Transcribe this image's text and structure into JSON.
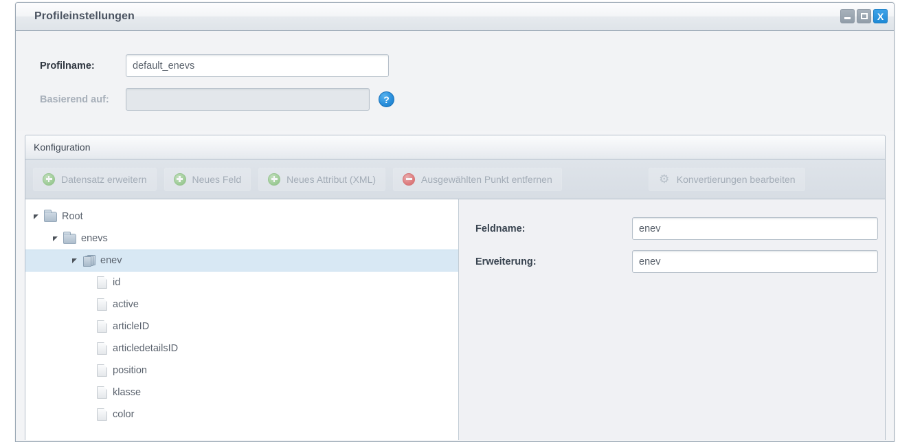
{
  "window": {
    "title": "Profileinstellungen",
    "controls": [
      {
        "name": "minimize",
        "glyph": "minimize-icon"
      },
      {
        "name": "maximize",
        "glyph": "maximize-icon"
      },
      {
        "name": "close",
        "glyph": "close-icon",
        "label": "X",
        "color": "#2a8fdc"
      }
    ]
  },
  "form": {
    "profilname_label": "Profilname:",
    "profilname_value": "default_enevs",
    "basierend_label": "Basierend auf:",
    "basierend_value": "",
    "help_icon_label": "?"
  },
  "konfiguration": {
    "title": "Konfiguration"
  },
  "toolbar": {
    "buttons": [
      {
        "label": "Datensatz erweitern",
        "icon": "plus-circle-icon",
        "enabled": false
      },
      {
        "label": "Neues Feld",
        "icon": "plus-circle-icon",
        "enabled": false
      },
      {
        "label": "Neues Attribut (XML)",
        "icon": "plus-circle-icon",
        "enabled": false
      },
      {
        "label": "Ausgewählten Punkt entfernen",
        "icon": "minus-circle-icon",
        "enabled": false
      },
      {
        "label": "Konvertierungen bearbeiten",
        "icon": "gear-icon",
        "enabled": false
      }
    ]
  },
  "tree": {
    "nodes": [
      {
        "label": "Root",
        "icon": "folder-icon",
        "level": 1,
        "expanded": true,
        "selected": false
      },
      {
        "label": "enevs",
        "icon": "folder-icon",
        "level": 2,
        "expanded": true,
        "selected": false
      },
      {
        "label": "enev",
        "icon": "stack-icon",
        "level": 3,
        "expanded": true,
        "selected": true
      },
      {
        "label": "id",
        "icon": "document-icon",
        "level": 4,
        "expanded": false,
        "selected": false
      },
      {
        "label": "active",
        "icon": "document-icon",
        "level": 4,
        "expanded": false,
        "selected": false
      },
      {
        "label": "articleID",
        "icon": "document-icon",
        "level": 4,
        "expanded": false,
        "selected": false
      },
      {
        "label": "articledetailsID",
        "icon": "document-icon",
        "level": 4,
        "expanded": false,
        "selected": false
      },
      {
        "label": "position",
        "icon": "document-icon",
        "level": 4,
        "expanded": false,
        "selected": false
      },
      {
        "label": "klasse",
        "icon": "document-icon",
        "level": 4,
        "expanded": false,
        "selected": false
      },
      {
        "label": "color",
        "icon": "document-icon",
        "level": 4,
        "expanded": false,
        "selected": false
      }
    ]
  },
  "detail": {
    "feldname_label": "Feldname:",
    "feldname_value": "enev",
    "erweiterung_label": "Erweiterung:",
    "erweiterung_value": "enev"
  },
  "colors": {
    "accent": "#2a8fdc",
    "selection": "#d8e8f4",
    "panel": "#f0f1f4",
    "border": "#b3bec9"
  }
}
